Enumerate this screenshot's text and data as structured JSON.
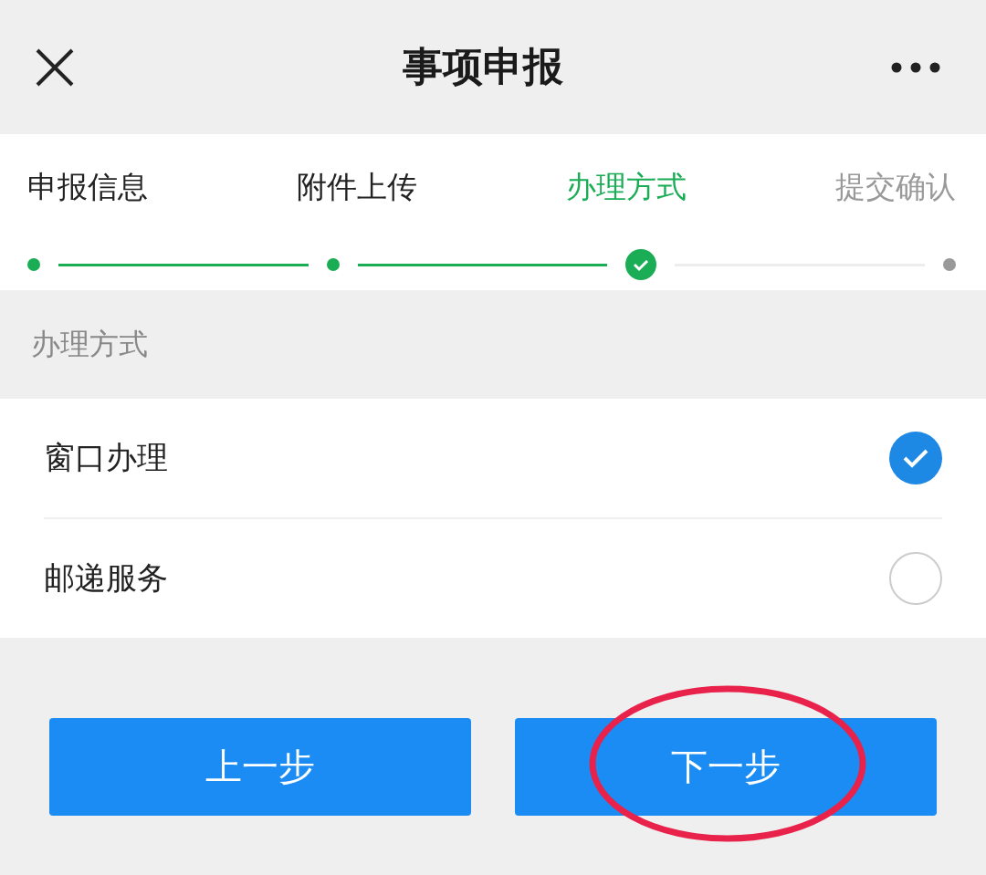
{
  "header": {
    "title": "事项申报"
  },
  "steps": [
    {
      "label": "申报信息",
      "done": true,
      "selected": false
    },
    {
      "label": "附件上传",
      "done": true,
      "selected": false
    },
    {
      "label": "办理方式",
      "done": true,
      "selected": true
    },
    {
      "label": "提交确认",
      "done": false,
      "selected": false
    }
  ],
  "section_title": "办理方式",
  "options": [
    {
      "label": "窗口办理",
      "selected": true
    },
    {
      "label": "邮递服务",
      "selected": false
    }
  ],
  "buttons": [
    {
      "label": "上一步",
      "circled": false
    },
    {
      "label": "下一步",
      "circled": true
    }
  ]
}
